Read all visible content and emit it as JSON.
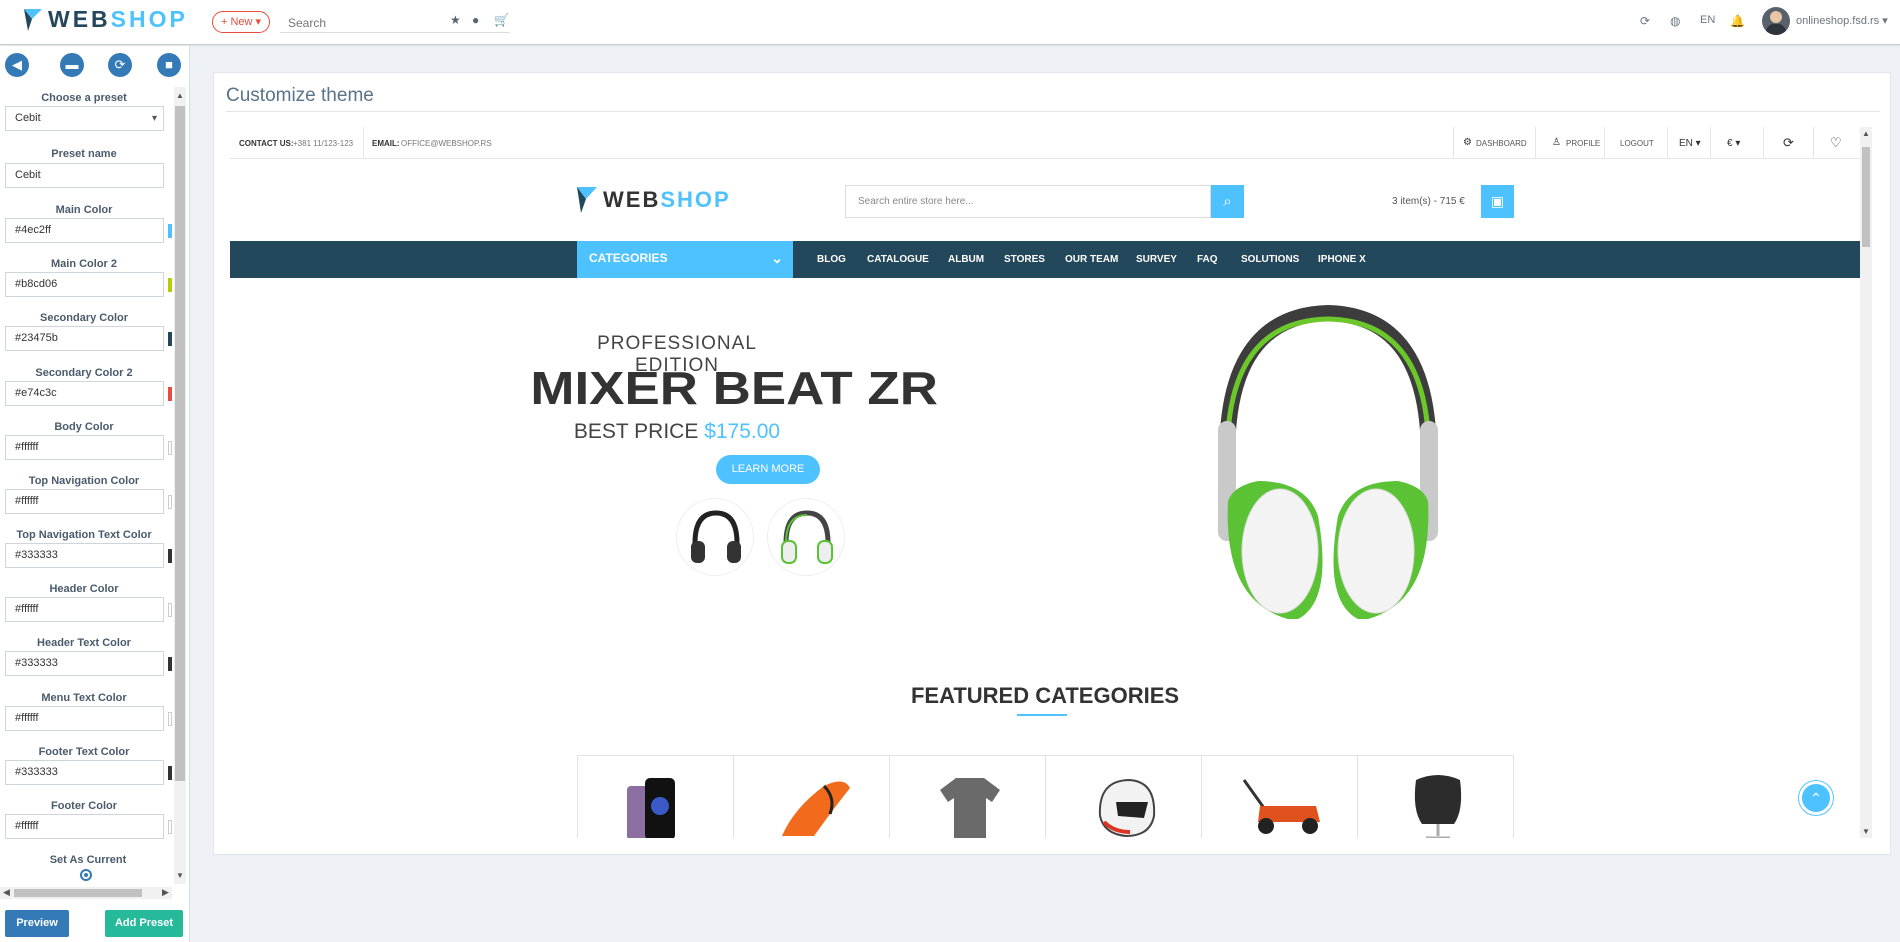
{
  "app": {
    "logo_left": "WEB",
    "logo_right": "SHOP"
  },
  "topbar": {
    "new_label": "+ New ▾",
    "search_placeholder": "Search",
    "language": "EN",
    "user": "onlineshop.fsd.rs ▾"
  },
  "sidebar": {
    "toolbar": [
      {
        "icon": "back-icon",
        "glyph": "◀"
      },
      {
        "icon": "trash-icon",
        "glyph": "🗑"
      },
      {
        "icon": "refresh-icon",
        "glyph": "⟳"
      },
      {
        "icon": "save-icon",
        "glyph": "💾"
      }
    ],
    "choose_preset_label": "Choose a preset",
    "preset_selected": "Cebit",
    "preset_name_label": "Preset name",
    "preset_name_value": "Cebit",
    "fields": [
      {
        "label": "Main Color",
        "value": "#4ec2ff",
        "swatch": "#4ec2ff"
      },
      {
        "label": "Main Color 2",
        "value": "#b8cd06",
        "swatch": "#b8cd06"
      },
      {
        "label": "Secondary Color",
        "value": "#23475b",
        "swatch": "#23475b"
      },
      {
        "label": "Secondary Color 2",
        "value": "#e74c3c",
        "swatch": "#e74c3c"
      },
      {
        "label": "Body Color",
        "value": "#ffffff",
        "swatch": "#ffffff"
      },
      {
        "label": "Top Navigation Color",
        "value": "#ffffff",
        "swatch": "#ffffff"
      },
      {
        "label": "Top Navigation Text Color",
        "value": "#333333",
        "swatch": "#333333"
      },
      {
        "label": "Header Color",
        "value": "#ffffff",
        "swatch": "#ffffff"
      },
      {
        "label": "Header Text Color",
        "value": "#333333",
        "swatch": "#333333"
      },
      {
        "label": "Menu Text Color",
        "value": "#ffffff",
        "swatch": "#ffffff"
      },
      {
        "label": "Footer Text Color",
        "value": "#333333",
        "swatch": "#333333"
      },
      {
        "label": "Footer Color",
        "value": "#ffffff",
        "swatch": "#ffffff"
      }
    ],
    "set_current_label": "Set As Current",
    "preview_label": "Preview",
    "add_preset_label": "Add Preset"
  },
  "main": {
    "title": "Customize theme"
  },
  "webshop": {
    "contact_label": "CONTACT US:",
    "contact_phone": "+381 11/123-123",
    "email_label": "EMAIL:",
    "email_value": "OFFICE@WEBSHOP.RS",
    "dashboard": "DASHBOARD",
    "profile": "PROFILE",
    "logout": "LOGOUT",
    "lang": "EN ▾",
    "currency": "€ ▾",
    "logo_left": "WEB",
    "logo_right": "SHOP",
    "search_placeholder": "Search entire store here...",
    "cart": "3 item(s) - 715 €",
    "categories": "CATEGORIES",
    "menu": [
      "BLOG",
      "CATALOGUE",
      "ALBUM",
      "STORES",
      "OUR TEAM",
      "SURVEY",
      "FAQ",
      "SOLUTIONS",
      "IPHONE X"
    ],
    "hero_sub": "PROFESSIONAL EDITION",
    "hero_title": "MIXER BEAT ZR",
    "hero_price_label": "BEST PRICE",
    "hero_price": "$175.00",
    "hero_button": "LEARN MORE",
    "featured_title": "FEATURED CATEGORIES",
    "category_icons": [
      "phone-icon",
      "shoe-icon",
      "shirt-icon",
      "helmet-icon",
      "lawnmower-icon",
      "chair-icon"
    ]
  }
}
